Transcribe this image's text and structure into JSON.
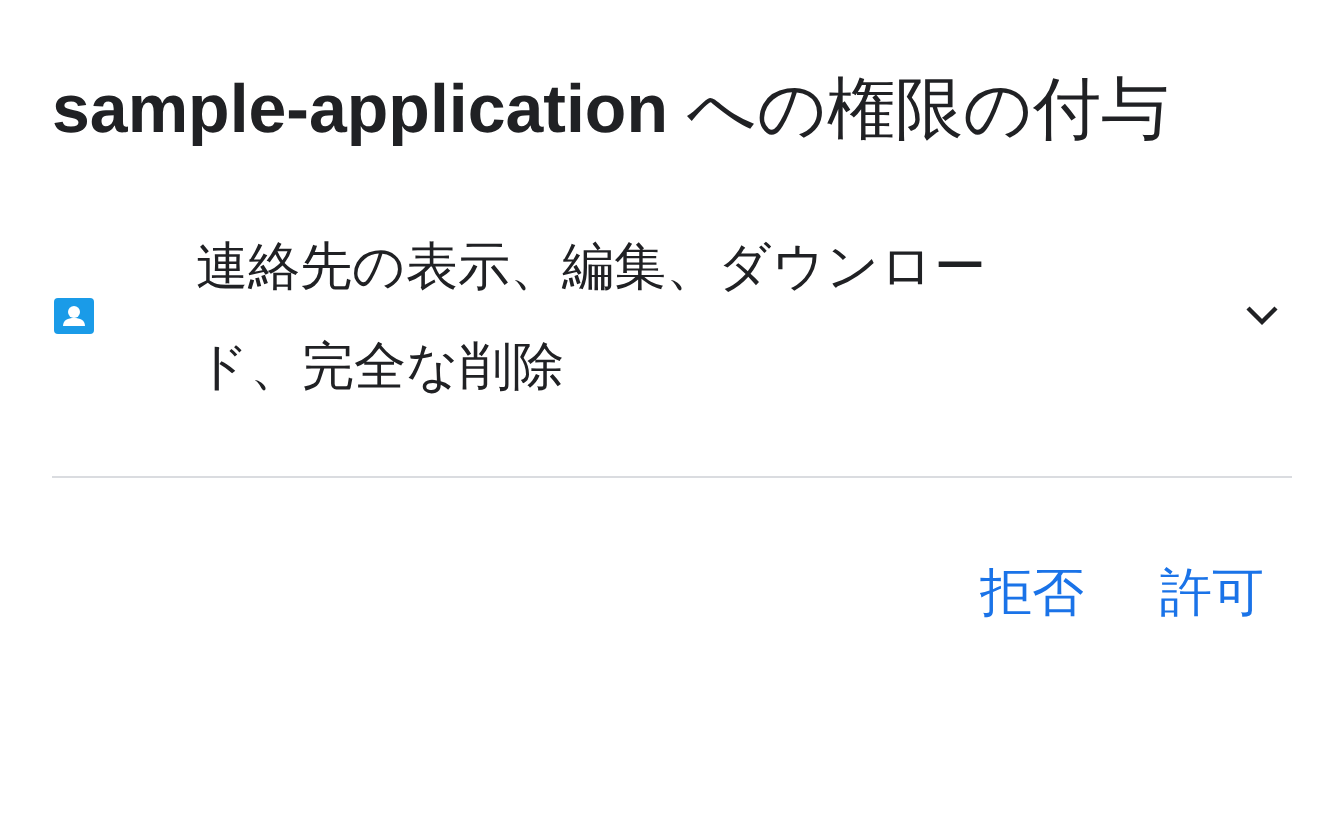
{
  "dialog": {
    "title": "**sample-application** への権限の付与"
  },
  "permissions": [
    {
      "text": "連絡先の表示、編集、ダウンロード、完全な削除",
      "expanded": false
    }
  ],
  "buttons": [
    {
      "label": "拒否"
    },
    {
      "label": "許可"
    }
  ]
}
